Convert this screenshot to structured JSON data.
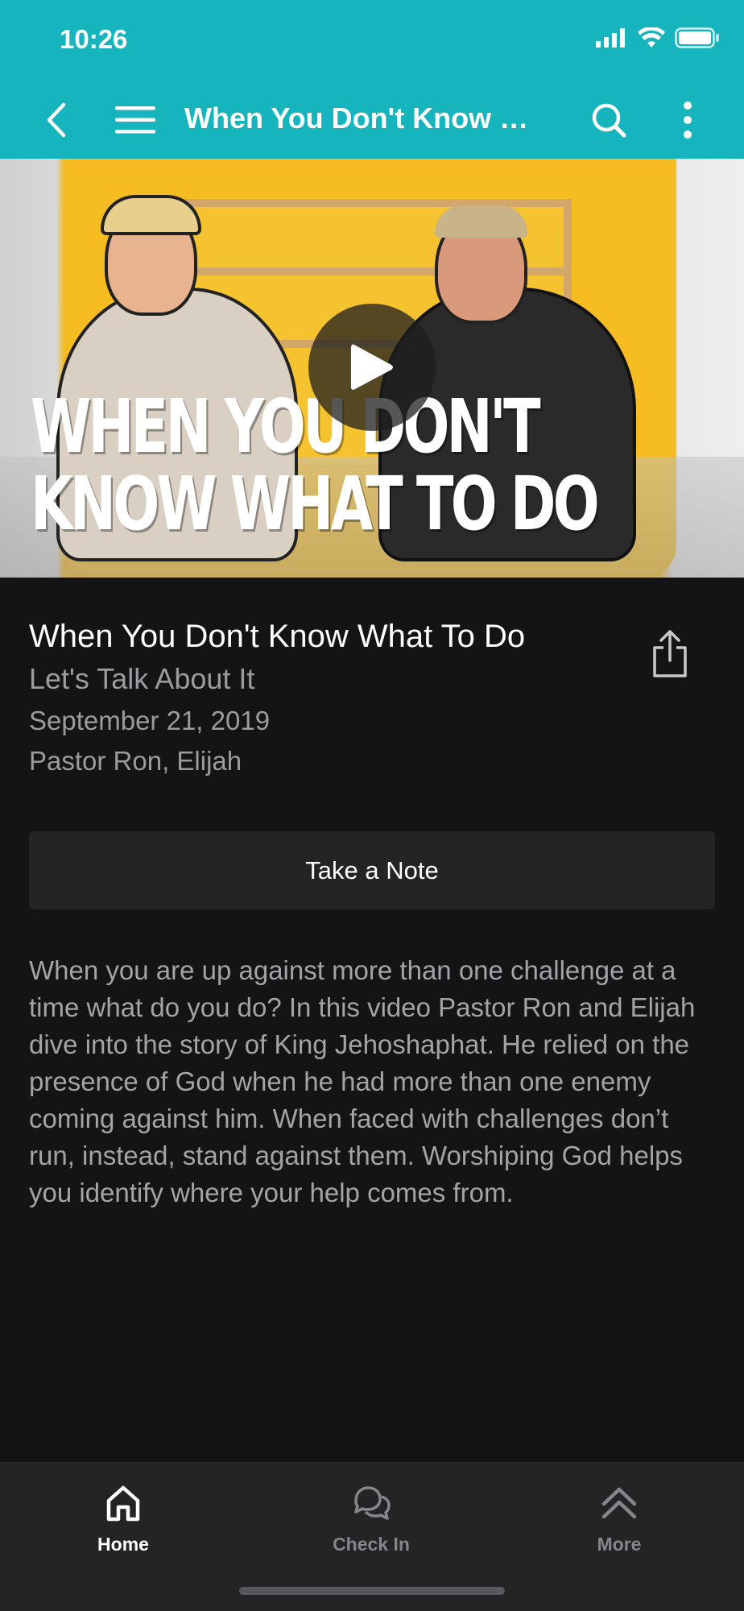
{
  "status_bar": {
    "time": "10:26"
  },
  "app_bar": {
    "title": "When You Don't Know What To Do"
  },
  "hero": {
    "caption_line1": "WHEN YOU DON'T",
    "caption_line2": "KNOW WHAT TO DO"
  },
  "details": {
    "title": "When You Don't Know What To Do",
    "series": "Let's Talk About It",
    "date": "September 21, 2019",
    "speakers": "Pastor Ron, Elijah"
  },
  "note_button": {
    "label": "Take a Note"
  },
  "description": "When you are up against more than one challenge at a time what do you do? In this video Pastor Ron and Elijah dive into the story of King Jehoshaphat. He relied on the presence of God when he had more than one enemy coming against him. When faced with challenges don’t run, instead, stand against them. Worshiping God helps you identify where your help comes from.",
  "tabs": [
    {
      "label": "Home",
      "icon": "home-icon",
      "active": true
    },
    {
      "label": "Check In",
      "icon": "chat-bubbles-icon",
      "active": false
    },
    {
      "label": "More",
      "icon": "double-chevron-up-icon",
      "active": false
    }
  ],
  "colors": {
    "header": "#16b4bd",
    "background": "#141417",
    "tab_bar": "#242427"
  }
}
